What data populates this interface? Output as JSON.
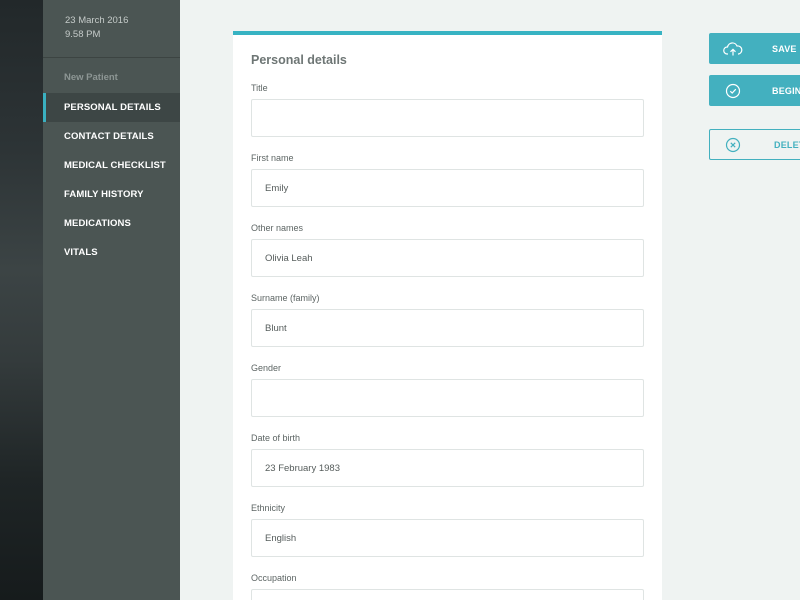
{
  "sidebar": {
    "date": "23 March 2016",
    "time": "9.58 PM",
    "section_label": "New Patient",
    "items": [
      {
        "label": "PERSONAL DETAILS",
        "active": true
      },
      {
        "label": "CONTACT DETAILS",
        "active": false
      },
      {
        "label": "MEDICAL CHECKLIST",
        "active": false
      },
      {
        "label": "FAMILY HISTORY",
        "active": false
      },
      {
        "label": "MEDICATIONS",
        "active": false
      },
      {
        "label": "VITALS",
        "active": false
      }
    ]
  },
  "form": {
    "title": "Personal details",
    "fields": [
      {
        "label": "Title",
        "value": ""
      },
      {
        "label": "First name",
        "value": "Emily"
      },
      {
        "label": "Other names",
        "value": "Olivia Leah"
      },
      {
        "label": "Surname (family)",
        "value": "Blunt"
      },
      {
        "label": "Gender",
        "value": ""
      },
      {
        "label": "Date of birth",
        "value": "23 February 1983"
      },
      {
        "label": "Ethnicity",
        "value": "English"
      },
      {
        "label": "Occupation",
        "value": ""
      }
    ]
  },
  "actions": {
    "save_label": "SAVE",
    "begin_label": "BEGIN",
    "delete_label": "DELETE",
    "save_icon": "cloud-upload-icon",
    "begin_icon": "check-circle-icon",
    "delete_icon": "x-circle-icon"
  },
  "colors": {
    "accent": "#43b0bf",
    "sidebar_bg": "#4b5553",
    "page_bg": "#eff3f2"
  }
}
